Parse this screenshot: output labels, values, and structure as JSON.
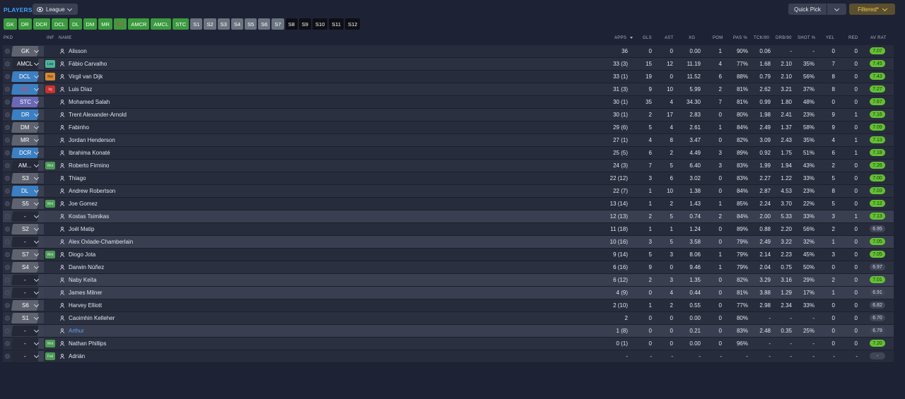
{
  "header": {
    "title": "PLAYERS",
    "view_label": "League",
    "quick_pick_label": "Quick Pick",
    "filter_label": "Filtered*"
  },
  "positions": [
    {
      "label": "GK",
      "style": "g"
    },
    {
      "label": "DR",
      "style": "g"
    },
    {
      "label": "DCR",
      "style": "g"
    },
    {
      "label": "DCL",
      "style": "g"
    },
    {
      "label": "DL",
      "style": "g"
    },
    {
      "label": "DM",
      "style": "g"
    },
    {
      "label": "MR",
      "style": "g"
    },
    {
      "label": "ML",
      "style": "gr"
    },
    {
      "label": "AMCR",
      "style": "g"
    },
    {
      "label": "AMCL",
      "style": "g"
    },
    {
      "label": "STC",
      "style": "g"
    },
    {
      "label": "S1",
      "style": "s"
    },
    {
      "label": "S2",
      "style": "s"
    },
    {
      "label": "S3",
      "style": "s"
    },
    {
      "label": "S4",
      "style": "s"
    },
    {
      "label": "S5",
      "style": "s"
    },
    {
      "label": "S6",
      "style": "s"
    },
    {
      "label": "S7",
      "style": "s"
    },
    {
      "label": "S8",
      "style": "k"
    },
    {
      "label": "S9",
      "style": "k"
    },
    {
      "label": "S10",
      "style": "k"
    },
    {
      "label": "S11",
      "style": "k"
    },
    {
      "label": "S12",
      "style": "k"
    }
  ],
  "columns": {
    "pkd": "PKD",
    "inf": "INF",
    "name": "NAME",
    "apps": "APPS",
    "gls": "GLS",
    "ast": "AST",
    "xg": "XG",
    "pom": "POM",
    "pas": "PAS %",
    "tck": "TCK/90",
    "drb": "DRB/90",
    "shot": "SHOT %",
    "yel": "YEL",
    "red": "RED",
    "avrat": "AV RAT"
  },
  "players": [
    {
      "pos": "GK",
      "pos_style": "gray",
      "pos_text_color": "#ffffff",
      "inf": "",
      "name": "Alisson",
      "apps": "36",
      "gls": "0",
      "ast": "0",
      "xg": "0.00",
      "pom": "1",
      "pas": "90%",
      "tck": "0.06",
      "drb": "-",
      "shot": "-",
      "yel": "0",
      "red": "0",
      "avr": "7.07",
      "avr_style": "hi",
      "row": "a"
    },
    {
      "pos": "AMCL",
      "pos_style": "none",
      "pos_text_color": "#ffffff",
      "inf": "Loa",
      "inf_style": "loa",
      "name": "Fábio Carvalho",
      "apps": "33 (3)",
      "gls": "15",
      "ast": "12",
      "xg": "11.19",
      "pom": "4",
      "pas": "77%",
      "tck": "1.68",
      "drb": "2.10",
      "shot": "35%",
      "yel": "7",
      "red": "0",
      "avr": "7.45",
      "avr_style": "hi",
      "row": "b"
    },
    {
      "pos": "DCL",
      "pos_style": "blue",
      "pos_text_color": "#ffffff",
      "inf": "Rst",
      "inf_style": "rst",
      "name": "Virgil van Dijk",
      "apps": "33 (1)",
      "gls": "19",
      "ast": "0",
      "xg": "11.52",
      "pom": "6",
      "pas": "88%",
      "tck": "0.79",
      "drb": "2.10",
      "shot": "56%",
      "yel": "8",
      "red": "0",
      "avr": "7.43",
      "avr_style": "hi",
      "row": "a"
    },
    {
      "pos": "ML",
      "pos_style": "blue",
      "pos_text_color": "#e24343",
      "inf": "Inj",
      "inf_style": "inj",
      "name": "Luis Díaz",
      "apps": "31 (3)",
      "gls": "9",
      "ast": "10",
      "xg": "5.99",
      "pom": "2",
      "pas": "81%",
      "tck": "2.62",
      "drb": "3.21",
      "shot": "37%",
      "yel": "8",
      "red": "0",
      "avr": "7.27",
      "avr_style": "hi",
      "row": "b"
    },
    {
      "pos": "STC",
      "pos_style": "purple",
      "pos_text_color": "#ffffff",
      "inf": "",
      "name": "Mohamed Salah",
      "apps": "30 (1)",
      "gls": "35",
      "ast": "4",
      "xg": "34.30",
      "pom": "7",
      "pas": "81%",
      "tck": "0.99",
      "drb": "1.80",
      "shot": "48%",
      "yel": "0",
      "red": "0",
      "avr": "7.67",
      "avr_style": "hi",
      "row": "a"
    },
    {
      "pos": "DR",
      "pos_style": "blue",
      "pos_text_color": "#ffffff",
      "inf": "",
      "name": "Trent Alexander-Arnold",
      "apps": "30 (1)",
      "gls": "2",
      "ast": "17",
      "xg": "2.83",
      "pom": "0",
      "pas": "80%",
      "tck": "1.98",
      "drb": "2.41",
      "shot": "23%",
      "yel": "9",
      "red": "1",
      "avr": "7.16",
      "avr_style": "hi",
      "row": "b"
    },
    {
      "pos": "DM",
      "pos_style": "gray",
      "pos_text_color": "#ffffff",
      "inf": "",
      "name": "Fabinho",
      "apps": "29 (6)",
      "gls": "5",
      "ast": "4",
      "xg": "2.61",
      "pom": "1",
      "pas": "84%",
      "tck": "2.49",
      "drb": "1.37",
      "shot": "58%",
      "yel": "9",
      "red": "0",
      "avr": "7.09",
      "avr_style": "hi",
      "row": "a"
    },
    {
      "pos": "MR",
      "pos_style": "gray",
      "pos_text_color": "#ffffff",
      "inf": "",
      "name": "Jordan Henderson",
      "apps": "27 (1)",
      "gls": "4",
      "ast": "8",
      "xg": "3.47",
      "pom": "0",
      "pas": "82%",
      "tck": "3.09",
      "drb": "2.43",
      "shot": "35%",
      "yel": "4",
      "red": "1",
      "avr": "7.13",
      "avr_style": "hi",
      "row": "b"
    },
    {
      "pos": "DCR",
      "pos_style": "blue",
      "pos_text_color": "#ffffff",
      "inf": "",
      "name": "Ibrahima Konaté",
      "apps": "25 (5)",
      "gls": "6",
      "ast": "2",
      "xg": "4.49",
      "pom": "3",
      "pas": "89%",
      "tck": "0.92",
      "drb": "1.75",
      "shot": "51%",
      "yel": "6",
      "red": "1",
      "avr": "7.18",
      "avr_style": "hi",
      "row": "a"
    },
    {
      "pos": "AM...",
      "pos_style": "none",
      "pos_text_color": "#ffffff",
      "inf": "Wnt",
      "inf_style": "wnt",
      "name": "Roberto Firmino",
      "apps": "24 (3)",
      "gls": "7",
      "ast": "5",
      "xg": "6.40",
      "pom": "3",
      "pas": "83%",
      "tck": "1.99",
      "drb": "1.94",
      "shot": "43%",
      "yel": "2",
      "red": "0",
      "avr": "7.26",
      "avr_style": "hi",
      "row": "b"
    },
    {
      "pos": "S3",
      "pos_style": "gray",
      "pos_text_color": "#ffffff",
      "inf": "",
      "name": "Thiago",
      "apps": "22 (12)",
      "gls": "3",
      "ast": "6",
      "xg": "3.02",
      "pom": "0",
      "pas": "83%",
      "tck": "2.27",
      "drb": "1.22",
      "shot": "33%",
      "yel": "5",
      "red": "0",
      "avr": "7.00",
      "avr_style": "hi",
      "row": "a"
    },
    {
      "pos": "DL",
      "pos_style": "blue",
      "pos_text_color": "#ffffff",
      "inf": "",
      "name": "Andrew Robertson",
      "apps": "22 (7)",
      "gls": "1",
      "ast": "10",
      "xg": "1.38",
      "pom": "0",
      "pas": "84%",
      "tck": "2.87",
      "drb": "4.53",
      "shot": "23%",
      "yel": "8",
      "red": "0",
      "avr": "7.03",
      "avr_style": "hi",
      "row": "b"
    },
    {
      "pos": "S5",
      "pos_style": "gray",
      "pos_text_color": "#ffffff",
      "inf": "Wnt",
      "inf_style": "wnt",
      "name": "Joe Gomez",
      "apps": "13 (14)",
      "gls": "1",
      "ast": "2",
      "xg": "1.43",
      "pom": "1",
      "pas": "85%",
      "tck": "2.24",
      "drb": "3.70",
      "shot": "22%",
      "yel": "5",
      "red": "0",
      "avr": "7.12",
      "avr_style": "hi",
      "row": "a"
    },
    {
      "pos": "-",
      "pos_style": "none",
      "pos_text_color": "#ffffff",
      "inf": "",
      "name": "Kostas Tsimikas",
      "apps": "12 (13)",
      "gls": "2",
      "ast": "5",
      "xg": "0.74",
      "pom": "2",
      "pas": "84%",
      "tck": "2.00",
      "drb": "5.33",
      "shot": "33%",
      "yel": "3",
      "red": "1",
      "avr": "7.13",
      "avr_style": "hi",
      "row": "c"
    },
    {
      "pos": "S2",
      "pos_style": "gray",
      "pos_text_color": "#ffffff",
      "inf": "",
      "name": "Joël Matip",
      "apps": "11 (18)",
      "gls": "1",
      "ast": "1",
      "xg": "1.24",
      "pom": "0",
      "pas": "89%",
      "tck": "0.88",
      "drb": "2.20",
      "shot": "56%",
      "yel": "2",
      "red": "0",
      "avr": "6.95",
      "avr_style": "lo",
      "row": "a"
    },
    {
      "pos": "-",
      "pos_style": "none",
      "pos_text_color": "#ffffff",
      "inf": "",
      "name": "Alex Oxlade-Chamberlain",
      "apps": "10 (16)",
      "gls": "3",
      "ast": "5",
      "xg": "3.58",
      "pom": "0",
      "pas": "79%",
      "tck": "2.49",
      "drb": "3.22",
      "shot": "32%",
      "yel": "1",
      "red": "0",
      "avr": "7.05",
      "avr_style": "hi",
      "row": "c"
    },
    {
      "pos": "S7",
      "pos_style": "gray",
      "pos_text_color": "#ffffff",
      "inf": "Wnt",
      "inf_style": "wnt",
      "name": "Diogo Jota",
      "apps": "9 (14)",
      "gls": "5",
      "ast": "3",
      "xg": "8.06",
      "pom": "1",
      "pas": "79%",
      "tck": "2.14",
      "drb": "2.23",
      "shot": "45%",
      "yel": "3",
      "red": "0",
      "avr": "7.05",
      "avr_style": "hi",
      "row": "a"
    },
    {
      "pos": "S4",
      "pos_style": "gray",
      "pos_text_color": "#ffffff",
      "inf": "",
      "name": "Darwin Núñez",
      "apps": "6 (16)",
      "gls": "9",
      "ast": "0",
      "xg": "9.46",
      "pom": "1",
      "pas": "79%",
      "tck": "2.04",
      "drb": "0.75",
      "shot": "50%",
      "yel": "0",
      "red": "0",
      "avr": "6.97",
      "avr_style": "lo",
      "row": "b"
    },
    {
      "pos": "-",
      "pos_style": "none",
      "pos_text_color": "#ffffff",
      "inf": "",
      "name": "Naby Keïta",
      "apps": "6 (12)",
      "gls": "2",
      "ast": "3",
      "xg": "1.35",
      "pom": "0",
      "pas": "82%",
      "tck": "3.29",
      "drb": "3.16",
      "shot": "29%",
      "yel": "2",
      "red": "0",
      "avr": "7.01",
      "avr_style": "hi",
      "row": "c"
    },
    {
      "pos": "-",
      "pos_style": "none",
      "pos_text_color": "#ffffff",
      "inf": "",
      "name": "James Milner",
      "apps": "4 (9)",
      "gls": "0",
      "ast": "4",
      "xg": "0.44",
      "pom": "0",
      "pas": "81%",
      "tck": "3.88",
      "drb": "1.29",
      "shot": "17%",
      "yel": "1",
      "red": "0",
      "avr": "6.91",
      "avr_style": "lo",
      "row": "c"
    },
    {
      "pos": "S6",
      "pos_style": "gray",
      "pos_text_color": "#ffffff",
      "inf": "",
      "name": "Harvey Elliott",
      "apps": "2 (10)",
      "gls": "1",
      "ast": "2",
      "xg": "0.55",
      "pom": "0",
      "pas": "77%",
      "tck": "2.98",
      "drb": "2.34",
      "shot": "33%",
      "yel": "0",
      "red": "0",
      "avr": "6.82",
      "avr_style": "lo",
      "row": "a"
    },
    {
      "pos": "S1",
      "pos_style": "gray",
      "pos_text_color": "#ffffff",
      "inf": "",
      "name": "Caoimhin Kelleher",
      "apps": "2",
      "gls": "0",
      "ast": "0",
      "xg": "0.00",
      "pom": "0",
      "pas": "80%",
      "tck": "-",
      "drb": "-",
      "shot": "-",
      "yel": "0",
      "red": "0",
      "avr": "6.70",
      "avr_style": "lo",
      "row": "b"
    },
    {
      "pos": "-",
      "pos_style": "none",
      "pos_text_color": "#ffffff",
      "inf": "",
      "name": "Arthur",
      "name_style": "link",
      "apps": "1 (8)",
      "gls": "0",
      "ast": "0",
      "xg": "0.21",
      "pom": "0",
      "pas": "83%",
      "tck": "2.48",
      "drb": "0.35",
      "shot": "25%",
      "yel": "0",
      "red": "0",
      "avr": "6.79",
      "avr_style": "lo",
      "row": "c"
    },
    {
      "pos": "-",
      "pos_style": "none",
      "pos_text_color": "#ffffff",
      "inf": "Wnt",
      "inf_style": "wnt",
      "name": "Nathan Phillips",
      "apps": "0 (1)",
      "gls": "0",
      "ast": "0",
      "xg": "0.00",
      "pom": "0",
      "pas": "96%",
      "tck": "-",
      "drb": "-",
      "shot": "-",
      "yel": "0",
      "red": "0",
      "avr": "7.20",
      "avr_style": "hi",
      "row": "b"
    },
    {
      "pos": "-",
      "pos_style": "none",
      "pos_text_color": "#ffffff",
      "inf": "Fnd",
      "inf_style": "fnd",
      "name": "Adrián",
      "apps": "-",
      "gls": "-",
      "ast": "-",
      "xg": "-",
      "pom": "-",
      "pas": "-",
      "tck": "-",
      "drb": "-",
      "shot": "-",
      "yel": "-",
      "red": "-",
      "avr": "-",
      "avr_style": "lo",
      "row": "a"
    }
  ]
}
